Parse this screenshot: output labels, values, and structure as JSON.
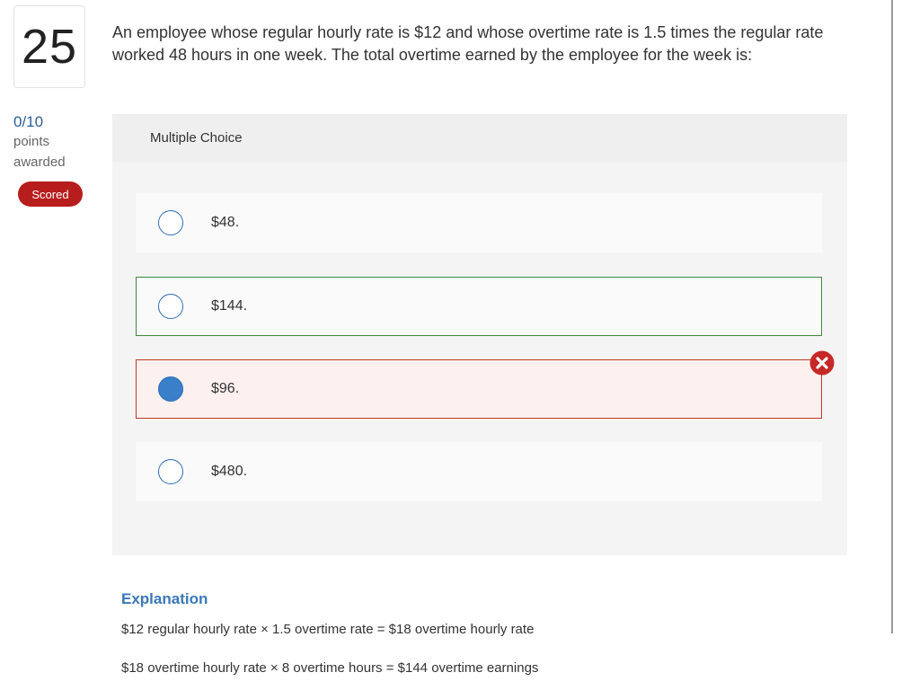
{
  "question_number": "25",
  "points": {
    "value": "0/10",
    "label_line1": "points",
    "label_line2": "awarded"
  },
  "badge": "Scored",
  "question_text": "An employee whose regular hourly rate is $12 and whose overtime rate is 1.5 times the regular rate worked 48 hours in one week. The total overtime earned by the employee for the week is:",
  "panel_title": "Multiple Choice",
  "choices": [
    {
      "label": "$48.",
      "state": "default",
      "selected": false
    },
    {
      "label": "$144.",
      "state": "correct",
      "selected": false
    },
    {
      "label": "$96.",
      "state": "incorrect",
      "selected": true
    },
    {
      "label": "$480.",
      "state": "default",
      "selected": false
    }
  ],
  "explanation": {
    "title": "Explanation",
    "lines": [
      "$12 regular hourly rate × 1.5 overtime rate = $18 overtime hourly rate",
      "$18 overtime hourly rate × 8 overtime hours = $144 overtime earnings"
    ]
  },
  "colors": {
    "accent": "#2d6db5",
    "correct": "#3f8a3f",
    "incorrect": "#c0392b",
    "badge": "#b81d1d"
  }
}
